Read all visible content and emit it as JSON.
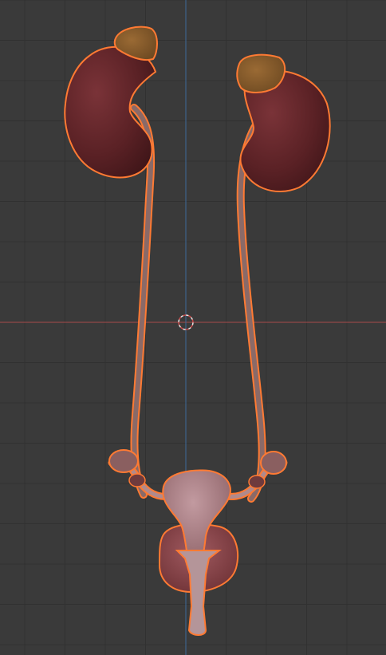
{
  "viewport": {
    "background_color": "#3a3a3a",
    "grid_color": "#313131",
    "x_axis_color": "#a84a4a",
    "y_axis_color": "#3f6a9a",
    "selection_outline_color": "#ff7a33",
    "cursor_icon": "3d-cursor-icon"
  },
  "scene": {
    "objects": [
      {
        "name": "left-kidney",
        "color": "#5c2226"
      },
      {
        "name": "right-kidney",
        "color": "#5c2226"
      },
      {
        "name": "left-adrenal-gland",
        "color": "#8a5a2a"
      },
      {
        "name": "right-adrenal-gland",
        "color": "#8a5a2a"
      },
      {
        "name": "left-ureter",
        "color": "#8a6a68"
      },
      {
        "name": "right-ureter",
        "color": "#8a6a68"
      },
      {
        "name": "uterus",
        "color": "#a97f84"
      },
      {
        "name": "bladder",
        "color": "#874448"
      },
      {
        "name": "left-ovary",
        "color": "#8a5f60"
      },
      {
        "name": "right-ovary",
        "color": "#8a5f60"
      },
      {
        "name": "vagina",
        "color": "#a97f84"
      }
    ]
  }
}
